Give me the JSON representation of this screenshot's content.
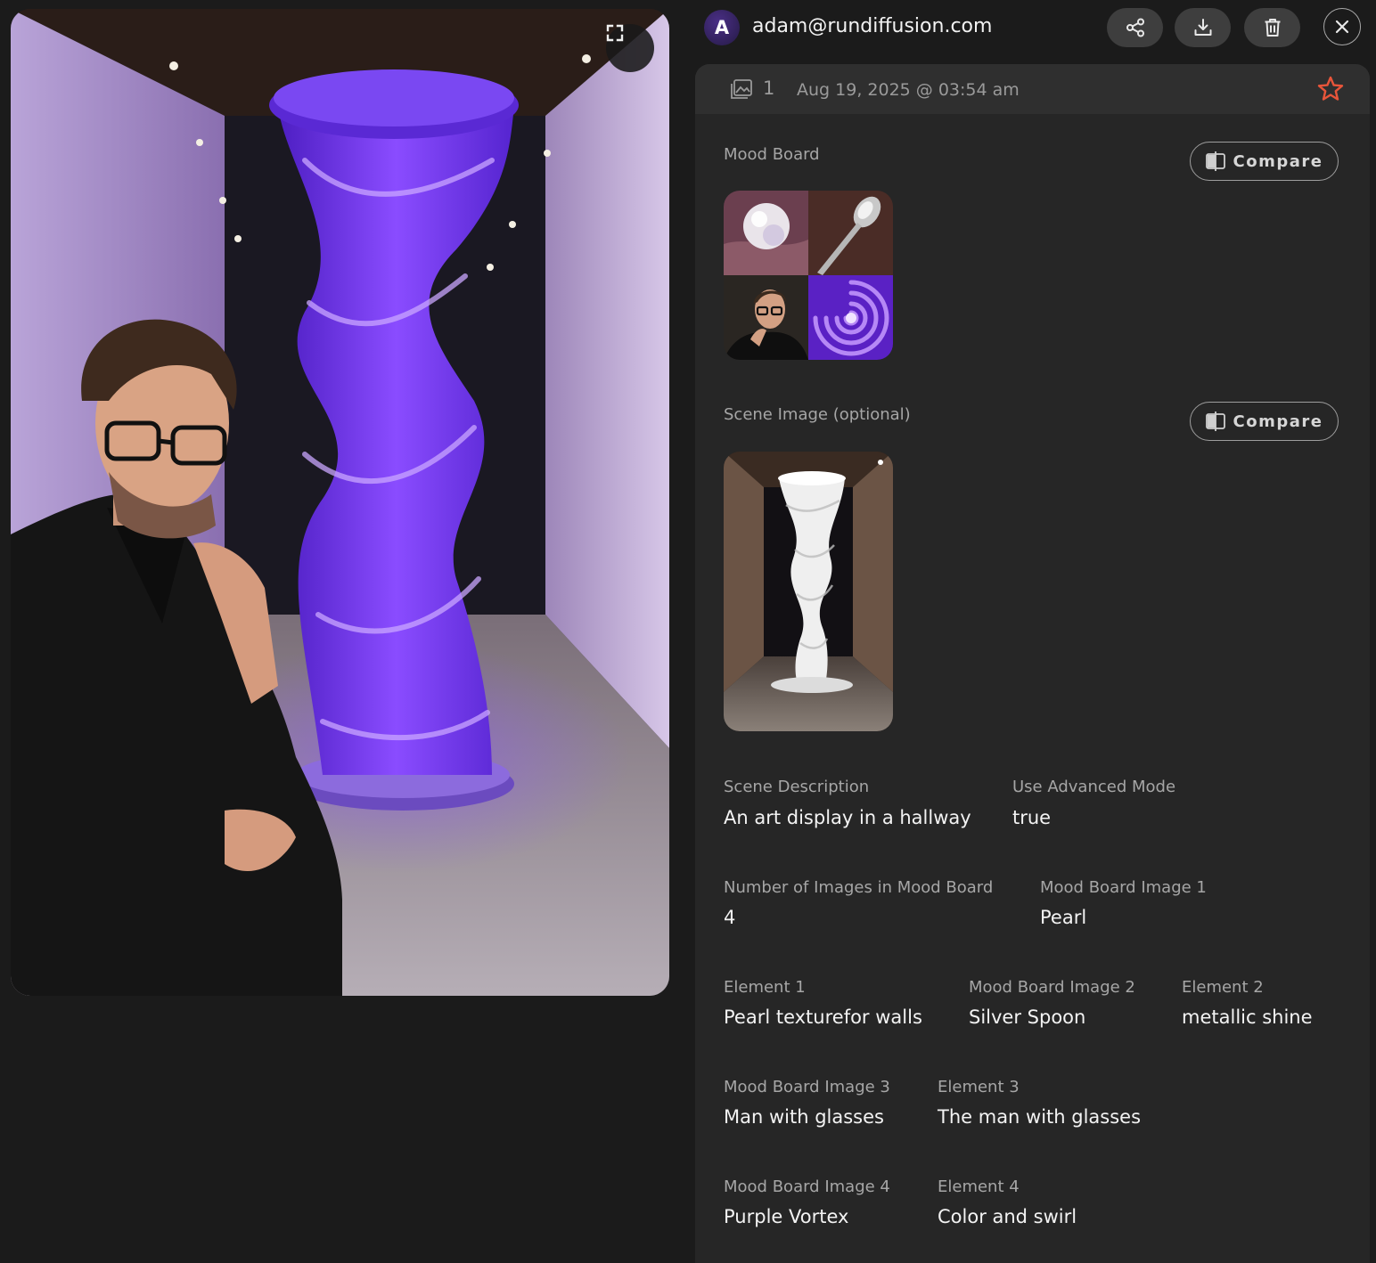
{
  "header": {
    "avatar_initial": "A",
    "user_email": "adam@rundiffusion.com",
    "actions": [
      "share-icon",
      "download-icon",
      "trash-icon",
      "close-icon"
    ]
  },
  "meta": {
    "image_count": "1",
    "date": "Aug 19, 2025 @ 03:54 am",
    "star_color": "#e8553a"
  },
  "sections": {
    "mood_board_label": "Mood Board",
    "scene_image_label": "Scene Image (optional)",
    "compare_label": "Compare"
  },
  "fields": {
    "scene_description": {
      "label": "Scene Description",
      "value": "An art display in a hallway"
    },
    "use_advanced_mode": {
      "label": "Use Advanced Mode",
      "value": "true"
    },
    "num_images": {
      "label": "Number of Images in Mood Board",
      "value": "4"
    },
    "mood_image_1": {
      "label": "Mood Board Image 1",
      "value": "Pearl"
    },
    "element_1": {
      "label": "Element 1",
      "value": "Pearl texturefor walls"
    },
    "mood_image_2": {
      "label": "Mood Board Image 2",
      "value": "Silver Spoon"
    },
    "element_2": {
      "label": "Element 2",
      "value": "metallic shine"
    },
    "mood_image_3": {
      "label": "Mood Board Image 3",
      "value": "Man with glasses"
    },
    "element_3": {
      "label": "Element 3",
      "value": "The man with glasses"
    },
    "mood_image_4": {
      "label": "Mood Board Image 4",
      "value": "Purple Vortex"
    },
    "element_4": {
      "label": "Element 4",
      "value": "Color and swirl"
    }
  },
  "colors": {
    "background": "#1b1b1b",
    "panel": "#262626",
    "accent_purple": "#7b3ff0"
  }
}
